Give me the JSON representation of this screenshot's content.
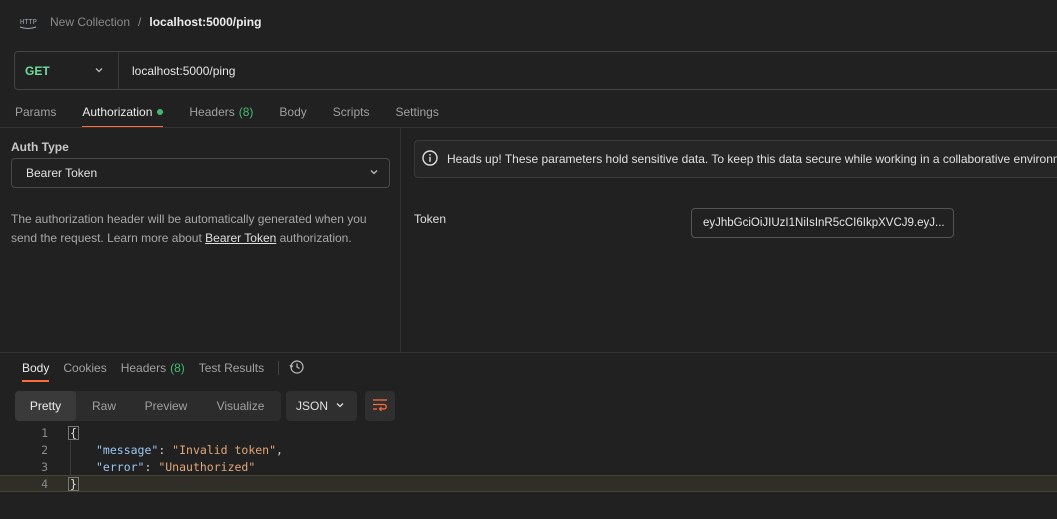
{
  "breadcrumb": {
    "icon": "http-icon",
    "collection": "New Collection",
    "separator": "/",
    "current": "localhost:5000/ping"
  },
  "request": {
    "method": "GET",
    "url": "localhost:5000/ping"
  },
  "request_tabs": [
    {
      "label": "Params"
    },
    {
      "label": "Authorization",
      "active": true
    },
    {
      "label": "Headers",
      "count": "(8)"
    },
    {
      "label": "Body"
    },
    {
      "label": "Scripts"
    },
    {
      "label": "Settings"
    }
  ],
  "auth": {
    "type_label": "Auth Type",
    "type_value": "Bearer Token",
    "desc_before": "The authorization header will be automatically generated when you send the request. Learn more about ",
    "desc_link": "Bearer Token",
    "desc_after": " authorization.",
    "alert": "Heads up! These parameters hold sensitive data. To keep this data secure while working in a collaborative environment",
    "token_label": "Token",
    "token_value": "eyJhbGciOiJIUzI1NiIsInR5cCI6IkpXVCJ9.eyJ..."
  },
  "response_tabs": [
    {
      "label": "Body",
      "active": true
    },
    {
      "label": "Cookies"
    },
    {
      "label": "Headers",
      "count": "(8)"
    },
    {
      "label": "Test Results"
    }
  ],
  "view_modes": [
    "Pretty",
    "Raw",
    "Preview",
    "Visualize"
  ],
  "format": "JSON",
  "code": {
    "line_numbers": [
      "1",
      "2",
      "3",
      "4"
    ],
    "open": "{",
    "close": "}",
    "key1": "\"message\"",
    "val1": "\"Invalid token\"",
    "key2": "\"error\"",
    "val2": "\"Unauthorized\""
  },
  "colors": {
    "accent": "#ff6c37",
    "method_get": "#6bdd9a",
    "status_green": "#3fbd71"
  }
}
